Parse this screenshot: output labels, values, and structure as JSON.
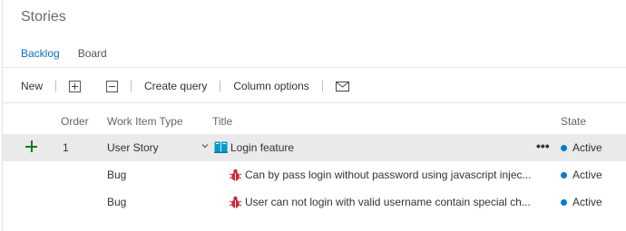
{
  "page": {
    "title": "Stories"
  },
  "tabs": [
    {
      "label": "Backlog",
      "active": true
    },
    {
      "label": "Board",
      "active": false
    }
  ],
  "toolbar": {
    "new_label": "New",
    "create_query_label": "Create query",
    "column_options_label": "Column options"
  },
  "columns": {
    "order": "Order",
    "work_item_type": "Work Item Type",
    "title": "Title",
    "state": "State"
  },
  "rows": [
    {
      "order": "1",
      "type": "User Story",
      "title": "Login feature",
      "state": "Active",
      "icon": "book-icon"
    },
    {
      "order": "",
      "type": "Bug",
      "title": "Can by pass login without password using javascript injec...",
      "state": "Active",
      "icon": "bug-icon"
    },
    {
      "order": "",
      "type": "Bug",
      "title": "User can not login with valid username contain special ch...",
      "state": "Active",
      "icon": "bug-icon"
    }
  ],
  "more_label": "•••",
  "colors": {
    "accent": "#106ebe",
    "add": "#107c10",
    "active_state": "#007acc",
    "bug": "#cc293d",
    "story": "#009ccc"
  }
}
